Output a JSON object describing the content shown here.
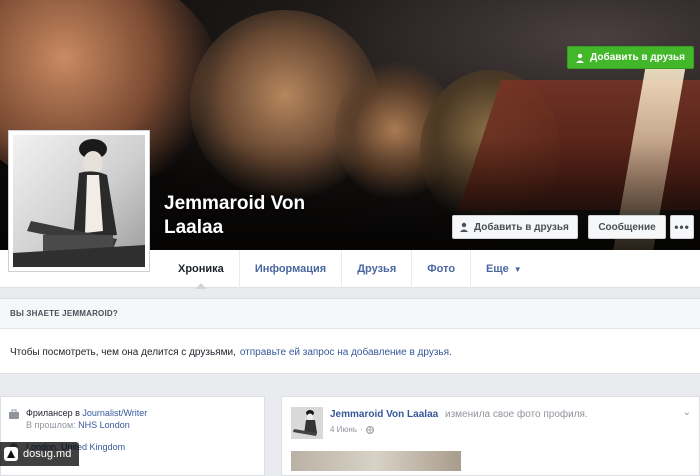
{
  "profile": {
    "name": "Jemmaroid Von Laalaa"
  },
  "cover_actions": {
    "add_friend": "Добавить в друзья",
    "message": "Сообщение",
    "more": "•••"
  },
  "tabs": [
    {
      "label": "Хроника",
      "active": true
    },
    {
      "label": "Информация"
    },
    {
      "label": "Друзья"
    },
    {
      "label": "Фото"
    },
    {
      "label": "Еще"
    }
  ],
  "know_box": {
    "heading": "ВЫ ЗНАЕТЕ JEMMAROID?",
    "text": "Чтобы посмотреть, чем она делится с друзьями,",
    "link": "отправьте ей запрос на добавление в друзья.",
    "button": "Добавить в друзья"
  },
  "intro": {
    "work_prefix": "Фрилансер в",
    "work_link": "Journalist/Writer",
    "past_prefix": "В прошлом:",
    "past_link": "NHS London",
    "location": "London, United Kingdom"
  },
  "post": {
    "author": "Jemmaroid Von Laalaa",
    "action": "изменила свое фото профиля.",
    "date": "4 Июнь",
    "privacy_icon": "globe-icon"
  },
  "watermark": {
    "text": "dosug.md"
  },
  "colors": {
    "link": "#365899",
    "green": "#42b72a",
    "background": "#e9ebee"
  }
}
